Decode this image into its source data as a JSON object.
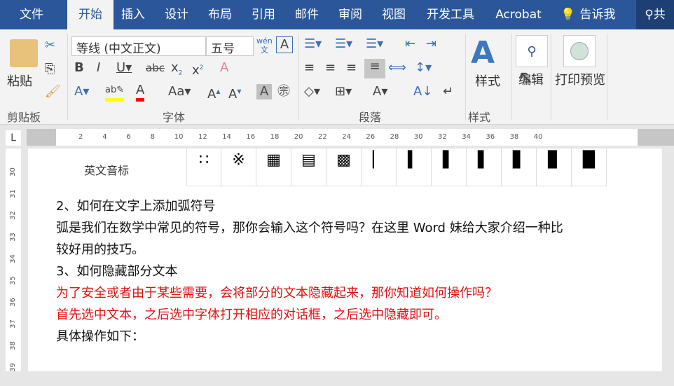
{
  "tabs": [
    "文件",
    "开始",
    "插入",
    "设计",
    "布局",
    "引用",
    "邮件",
    "审阅",
    "视图",
    "开发工具",
    "Acrobat",
    "告诉我",
    "共"
  ],
  "ribbon": {
    "clipboard": {
      "paste": "粘贴",
      "group": "剪贴板"
    },
    "font": {
      "name": "等线 (中文正文)",
      "size": "五号",
      "phonetic": "wén\n文",
      "group": "字体",
      "aa": "Aa",
      "highlight_color": "#ffff00",
      "font_color": "#ff0000"
    },
    "paragraph": {
      "group": "段落"
    },
    "styles": {
      "label": "样式",
      "group": "样式"
    },
    "editing": {
      "label": "编辑"
    },
    "print_preview": {
      "label": "打印预览"
    }
  },
  "ruler": {
    "marks": [
      "2",
      "4",
      "6",
      "8",
      "10",
      "12",
      "14",
      "16",
      "18",
      "20",
      "22",
      "24",
      "26",
      "28",
      "30",
      "32",
      "34",
      "36",
      "38",
      "40"
    ],
    "vertical": [
      "30",
      "31",
      "32",
      "33",
      "34",
      "35",
      "36",
      "37",
      "38",
      "39"
    ]
  },
  "document": {
    "table_label": "英文音标",
    "lines": [
      {
        "text": "2、如何在文字上添加弧符号",
        "color": "#111111"
      },
      {
        "text": "弧是我们在数学中常见的符号，那你会输入这个符号吗？在这里 Word 妹给大家介绍一种比",
        "color": "#111111"
      },
      {
        "text": "较好用的技巧。",
        "color": "#111111"
      },
      {
        "text": "3、如何隐藏部分文本",
        "color": "#111111"
      },
      {
        "text": "为了安全或者由于某些需要，会将部分的文本隐藏起来，那你知道如何操作吗？",
        "color": "#e01010"
      },
      {
        "text": "首先选中文本，之后选中字体打开相应的对话框，之后选中隐藏即可。",
        "color": "#e01010"
      },
      {
        "text": "具体操作如下：",
        "color": "#111111"
      }
    ]
  }
}
